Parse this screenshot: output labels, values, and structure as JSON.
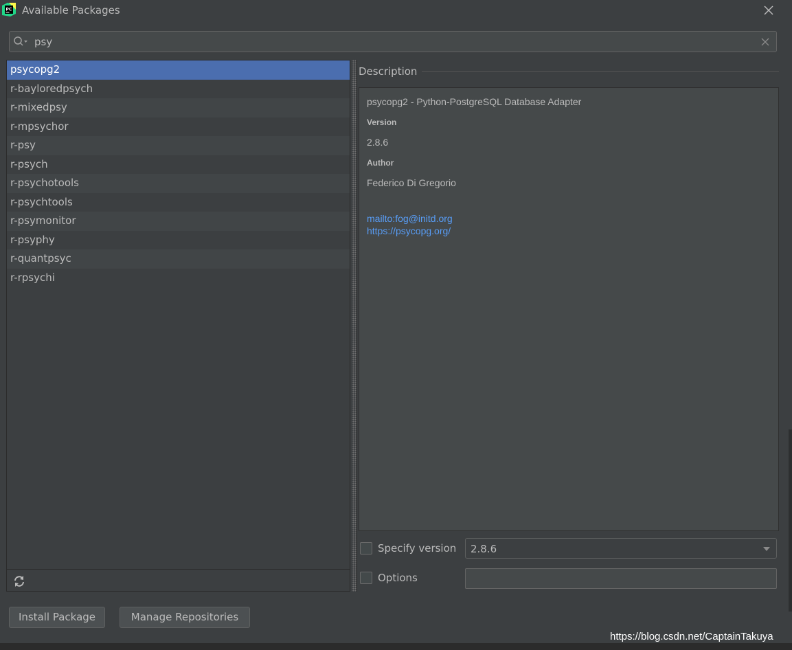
{
  "window": {
    "title": "Available Packages",
    "app_icon": "pycharm-logo-icon",
    "app_icon_text": "PC",
    "close_icon": "close-icon"
  },
  "search": {
    "value": "psy",
    "search_icon": "search-icon",
    "clear_icon": "clear-icon"
  },
  "packages": [
    "psycopg2",
    "r-bayloredpsych",
    "r-mixedpsy",
    "r-mpsychor",
    "r-psy",
    "r-psych",
    "r-psychotools",
    "r-psychtools",
    "r-psymonitor",
    "r-psyphy",
    "r-quantpsyc",
    "r-rpsychi"
  ],
  "selected_package": "psycopg2",
  "list_footer": {
    "refresh_icon": "refresh-icon"
  },
  "description": {
    "header": "Description",
    "summary": "psycopg2 - Python-PostgreSQL Database Adapter",
    "version_label": "Version",
    "version_value": "2.8.6",
    "author_label": "Author",
    "author_value": "Federico Di Gregorio",
    "links": [
      "mailto:fog@initd.org",
      "https://psycopg.org/"
    ]
  },
  "specify_version": {
    "label": "Specify version",
    "checked": false,
    "value": "2.8.6",
    "dropdown_icon": "chevron-down-icon"
  },
  "options": {
    "label": "Options",
    "checked": false,
    "value": ""
  },
  "buttons": {
    "install": "Install Package",
    "manage": "Manage Repositories"
  },
  "watermark": "https://blog.csdn.net/CaptainTakuya",
  "colors": {
    "background": "#3c3f41",
    "selection": "#4b6eaf",
    "link": "#589df6",
    "text": "#bbbbbb"
  }
}
